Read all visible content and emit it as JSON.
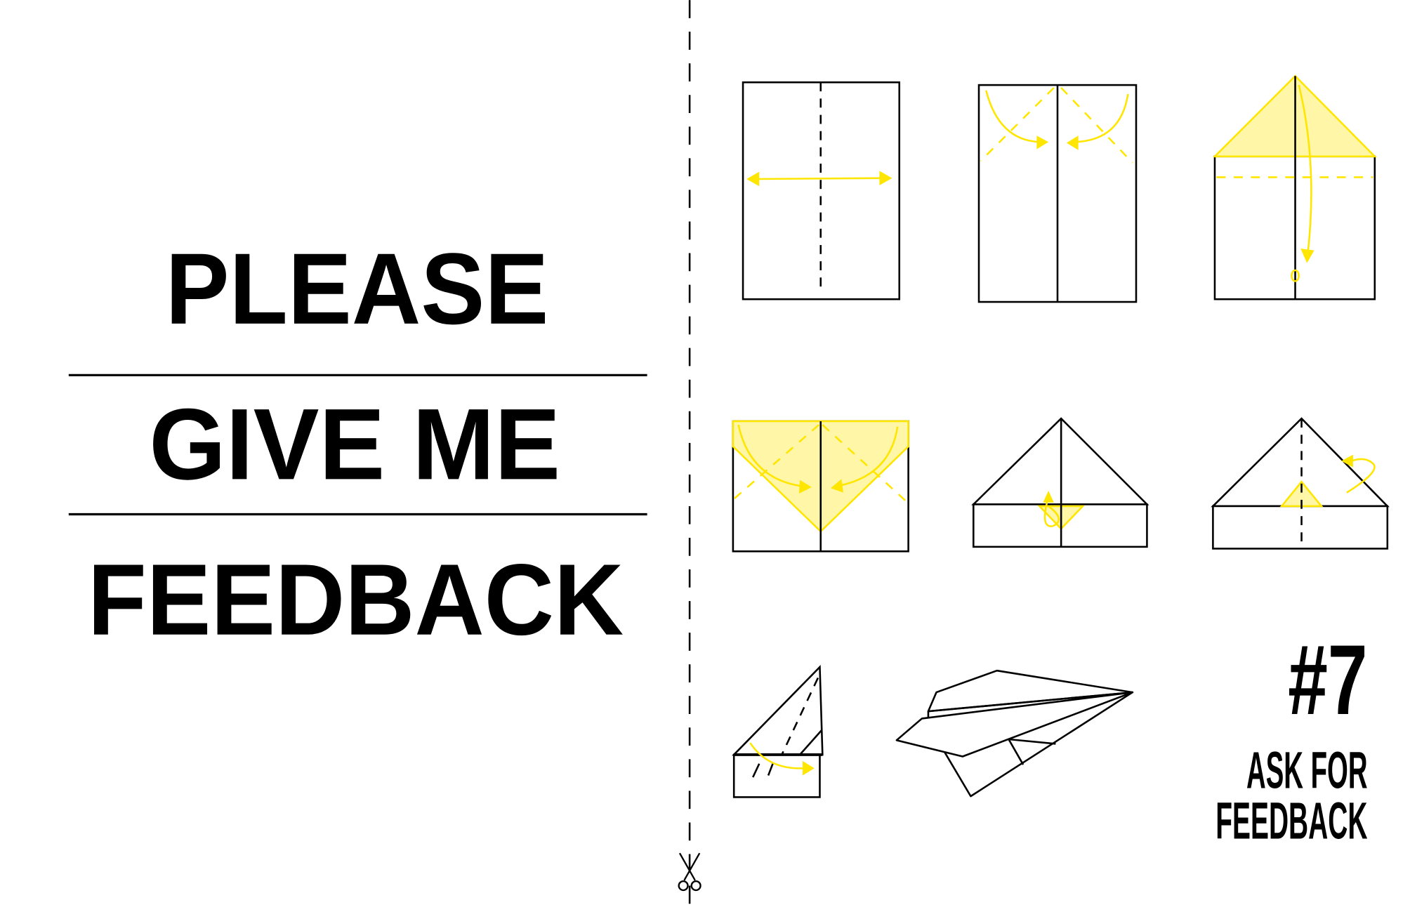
{
  "headline": {
    "line1": "PLEASE",
    "line2": "GIVE ME",
    "line3": "FEEDBACK"
  },
  "tip": {
    "number": "#7",
    "title_line1": "ASK FOR",
    "title_line2": "FEEDBACK"
  },
  "instructions": {
    "steps": 8,
    "subject": "paper-airplane-folding"
  },
  "colors": {
    "accent": "#ffe600",
    "accent_fill": "#fff6a8",
    "ink": "#000000"
  },
  "icons": {
    "cut_marker": "scissors-icon"
  }
}
